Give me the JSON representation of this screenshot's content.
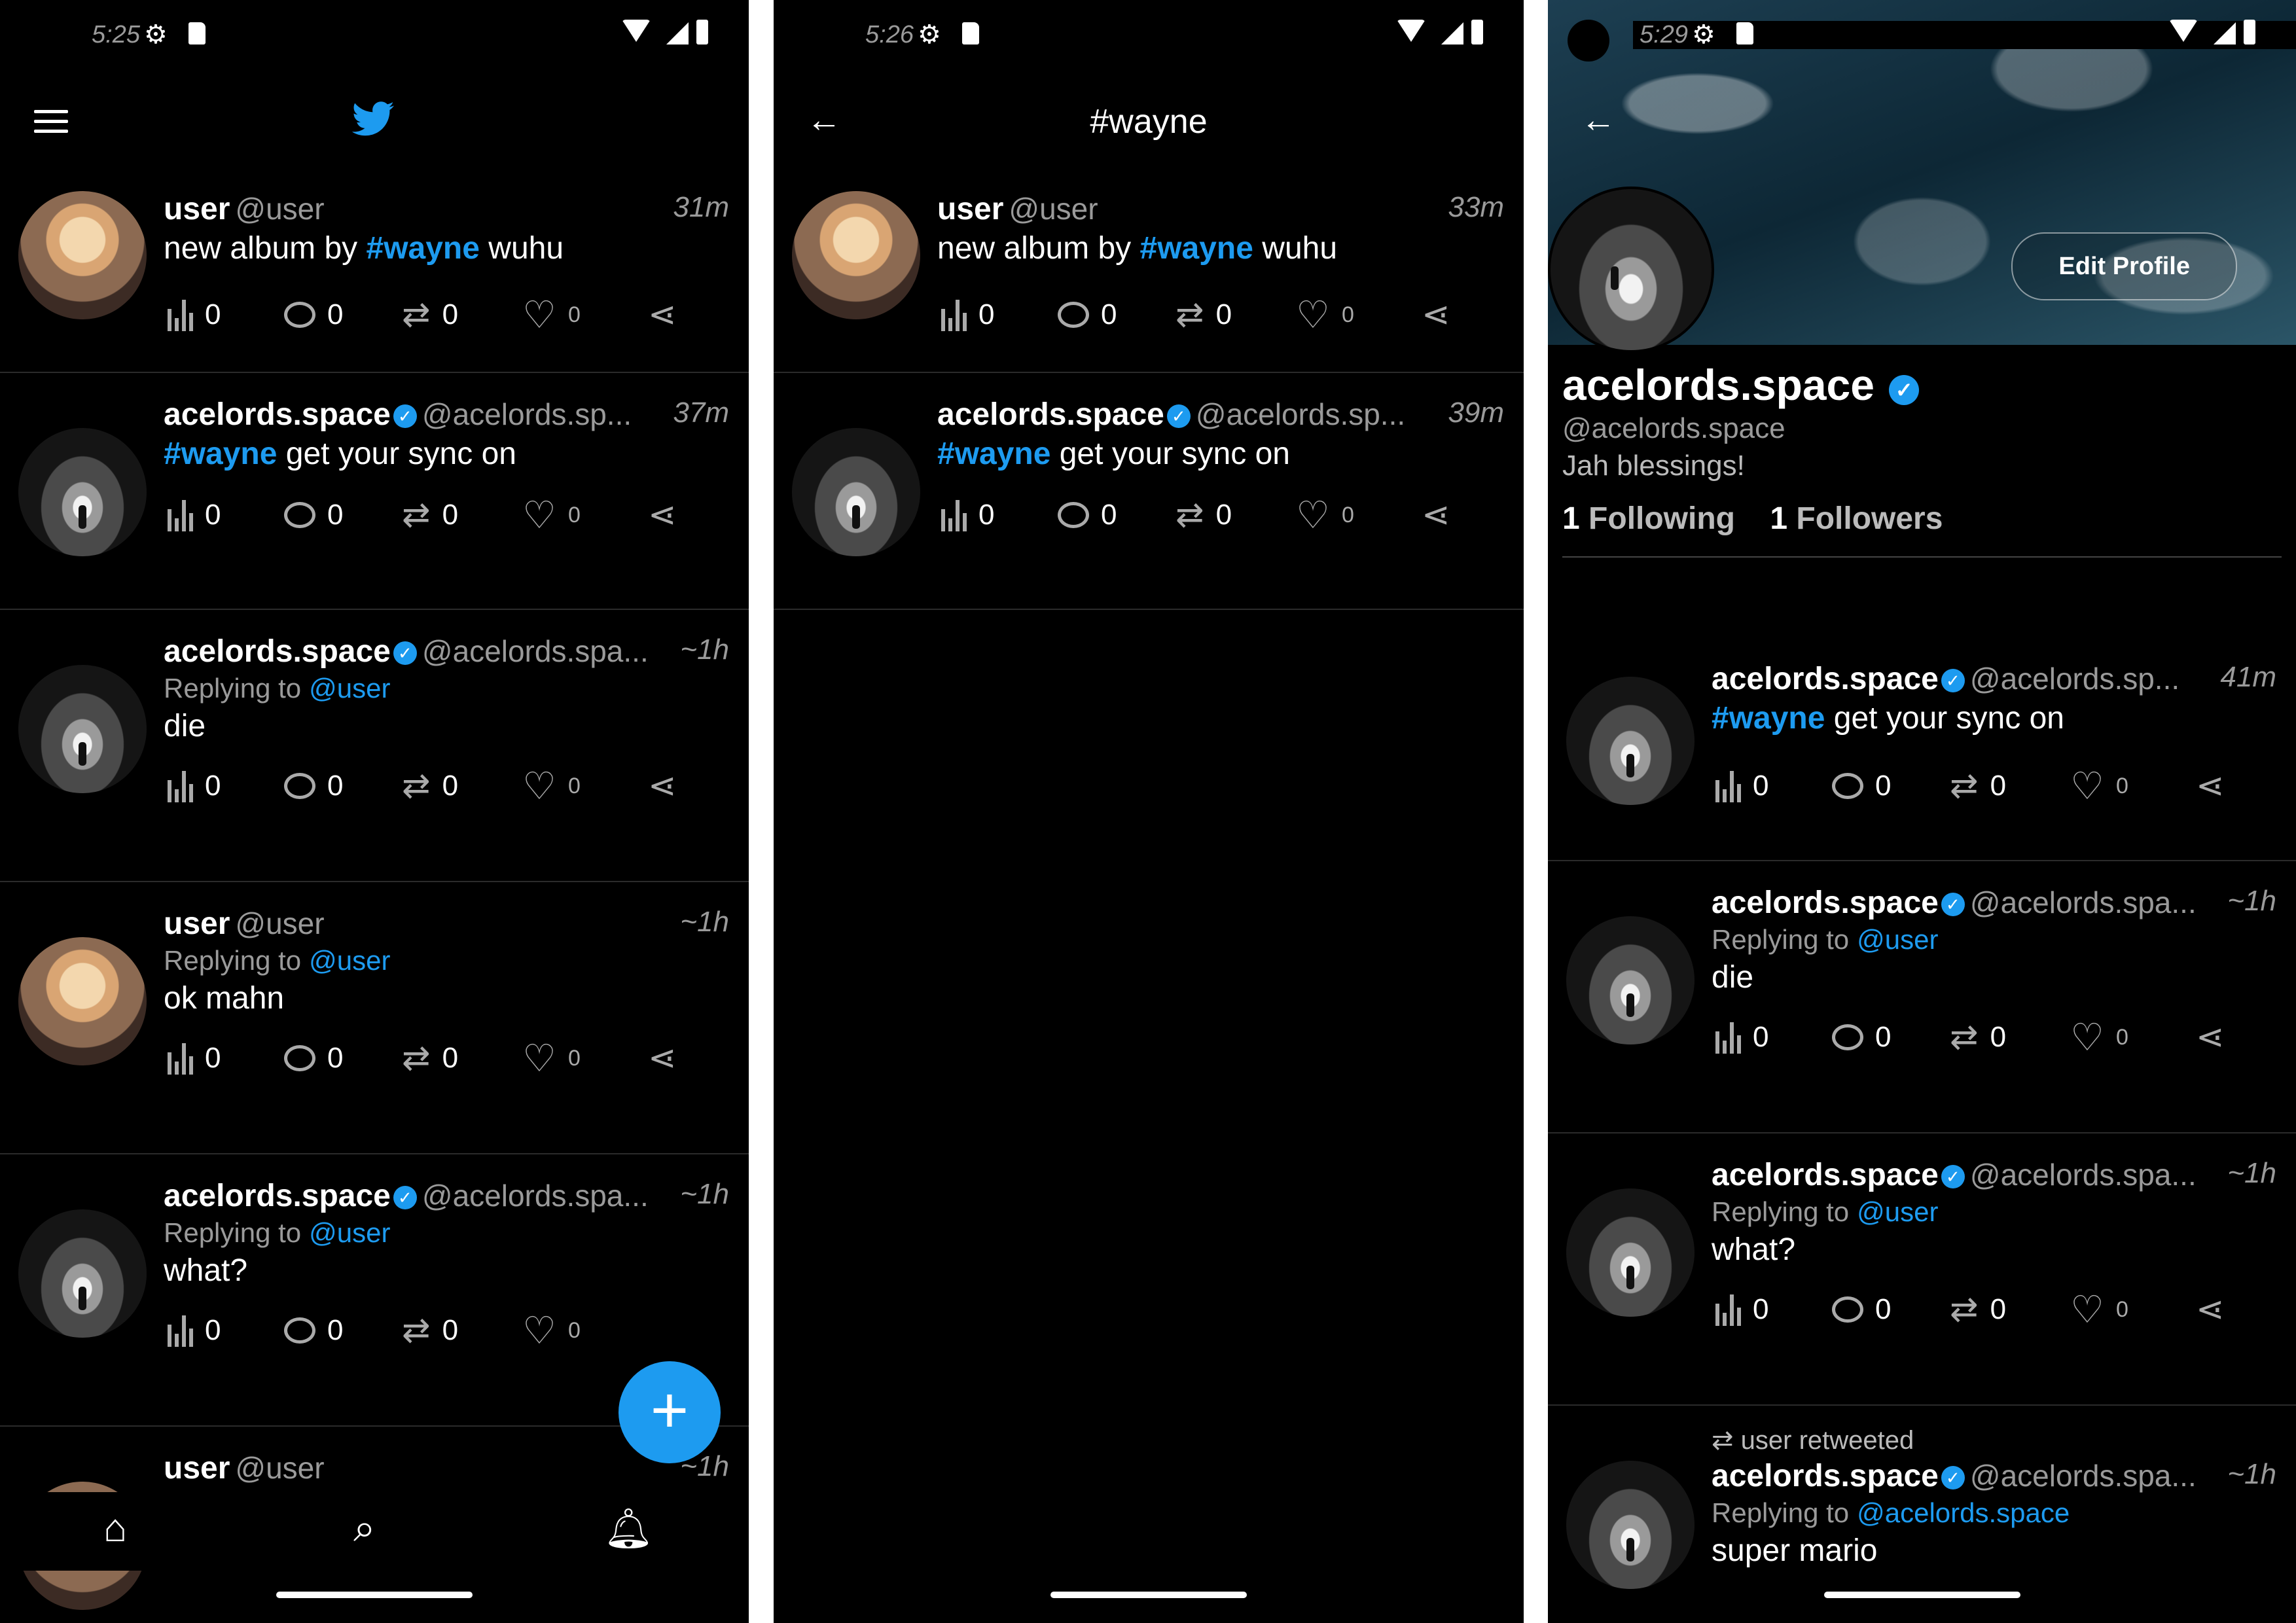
{
  "status": [
    {
      "time": "5:25"
    },
    {
      "time": "5:26"
    },
    {
      "time": "5:29"
    }
  ],
  "colors": {
    "accent": "#1d9bf0",
    "background": "#000000",
    "muted": "#9a9a9a"
  },
  "icons": [
    "menu-icon",
    "bird-icon",
    "back-icon",
    "views-icon",
    "comment-icon",
    "retweet-icon",
    "heart-icon",
    "share-icon",
    "plus-icon",
    "home-icon",
    "search-icon",
    "bell-icon",
    "verified-icon"
  ],
  "screen1": {
    "tweets": [
      {
        "name": "user",
        "handle": "@user",
        "time": "31m",
        "reply_label": "",
        "reply_to": "",
        "hashtag": "#wayne",
        "text_before": "new album by ",
        "text_after": " wuhu",
        "plain_text": "",
        "views": "0",
        "comments": "0",
        "retweets": "0",
        "likes": "0"
      },
      {
        "name": "acelords.space",
        "handle": "@acelords.sp...",
        "time": "37m",
        "hashtag": "#wayne",
        "text_before": "",
        "text_after": " get your sync on",
        "views": "0",
        "comments": "0",
        "retweets": "0",
        "likes": "0"
      },
      {
        "name": "acelords.space",
        "handle": "@acelords.spa...",
        "time": "~1h",
        "reply_label": "Replying to",
        "reply_to": "@user",
        "plain_text": "die",
        "views": "0",
        "comments": "0",
        "retweets": "0",
        "likes": "0"
      },
      {
        "name": "user",
        "handle": "@user",
        "time": "~1h",
        "reply_label": "Replying to",
        "reply_to": "@user",
        "plain_text": "ok mahn",
        "views": "0",
        "comments": "0",
        "retweets": "0",
        "likes": "0"
      },
      {
        "name": "acelords.space",
        "handle": "@acelords.spa...",
        "time": "~1h",
        "reply_label": "Replying to",
        "reply_to": "@user",
        "plain_text": "what?",
        "views": "0",
        "comments": "0",
        "retweets": "0",
        "likes": "0"
      },
      {
        "name": "user",
        "handle": "@user",
        "time": "~1h"
      }
    ]
  },
  "screen2": {
    "title": "#wayne",
    "tweets": [
      {
        "name": "user",
        "handle": "@user",
        "time": "33m",
        "hashtag": "#wayne",
        "text_before": "new album by ",
        "text_after": " wuhu",
        "views": "0",
        "comments": "0",
        "retweets": "0",
        "likes": "0"
      },
      {
        "name": "acelords.space",
        "handle": "@acelords.sp...",
        "time": "39m",
        "hashtag": "#wayne",
        "text_before": "",
        "text_after": " get your sync on",
        "views": "0",
        "comments": "0",
        "retweets": "0",
        "likes": "0"
      }
    ]
  },
  "screen3": {
    "profile": {
      "edit_label": "Edit Profile",
      "name": "acelords.space",
      "handle": "@acelords.space",
      "bio": "Jah blessings!",
      "following_count": "1",
      "following_label": "Following",
      "followers_count": "1",
      "followers_label": "Followers"
    },
    "tweets": [
      {
        "name": "acelords.space",
        "handle": "@acelords.sp...",
        "time": "41m",
        "hashtag": "#wayne",
        "text_before": "",
        "text_after": " get your sync on",
        "views": "0",
        "comments": "0",
        "retweets": "0",
        "likes": "0"
      },
      {
        "name": "acelords.space",
        "handle": "@acelords.spa...",
        "time": "~1h",
        "reply_label": "Replying to",
        "reply_to": "@user",
        "plain_text": "die",
        "views": "0",
        "comments": "0",
        "retweets": "0",
        "likes": "0"
      },
      {
        "name": "acelords.space",
        "handle": "@acelords.spa...",
        "time": "~1h",
        "reply_label": "Replying to",
        "reply_to": "@user",
        "plain_text": "what?",
        "views": "0",
        "comments": "0",
        "retweets": "0",
        "likes": "0"
      },
      {
        "retweeted_by": "user retweeted",
        "name": "acelords.space",
        "handle": "@acelords.spa...",
        "time": "~1h",
        "reply_label": "Replying to",
        "reply_to": "@acelords.space",
        "plain_text": "super mario"
      }
    ]
  }
}
